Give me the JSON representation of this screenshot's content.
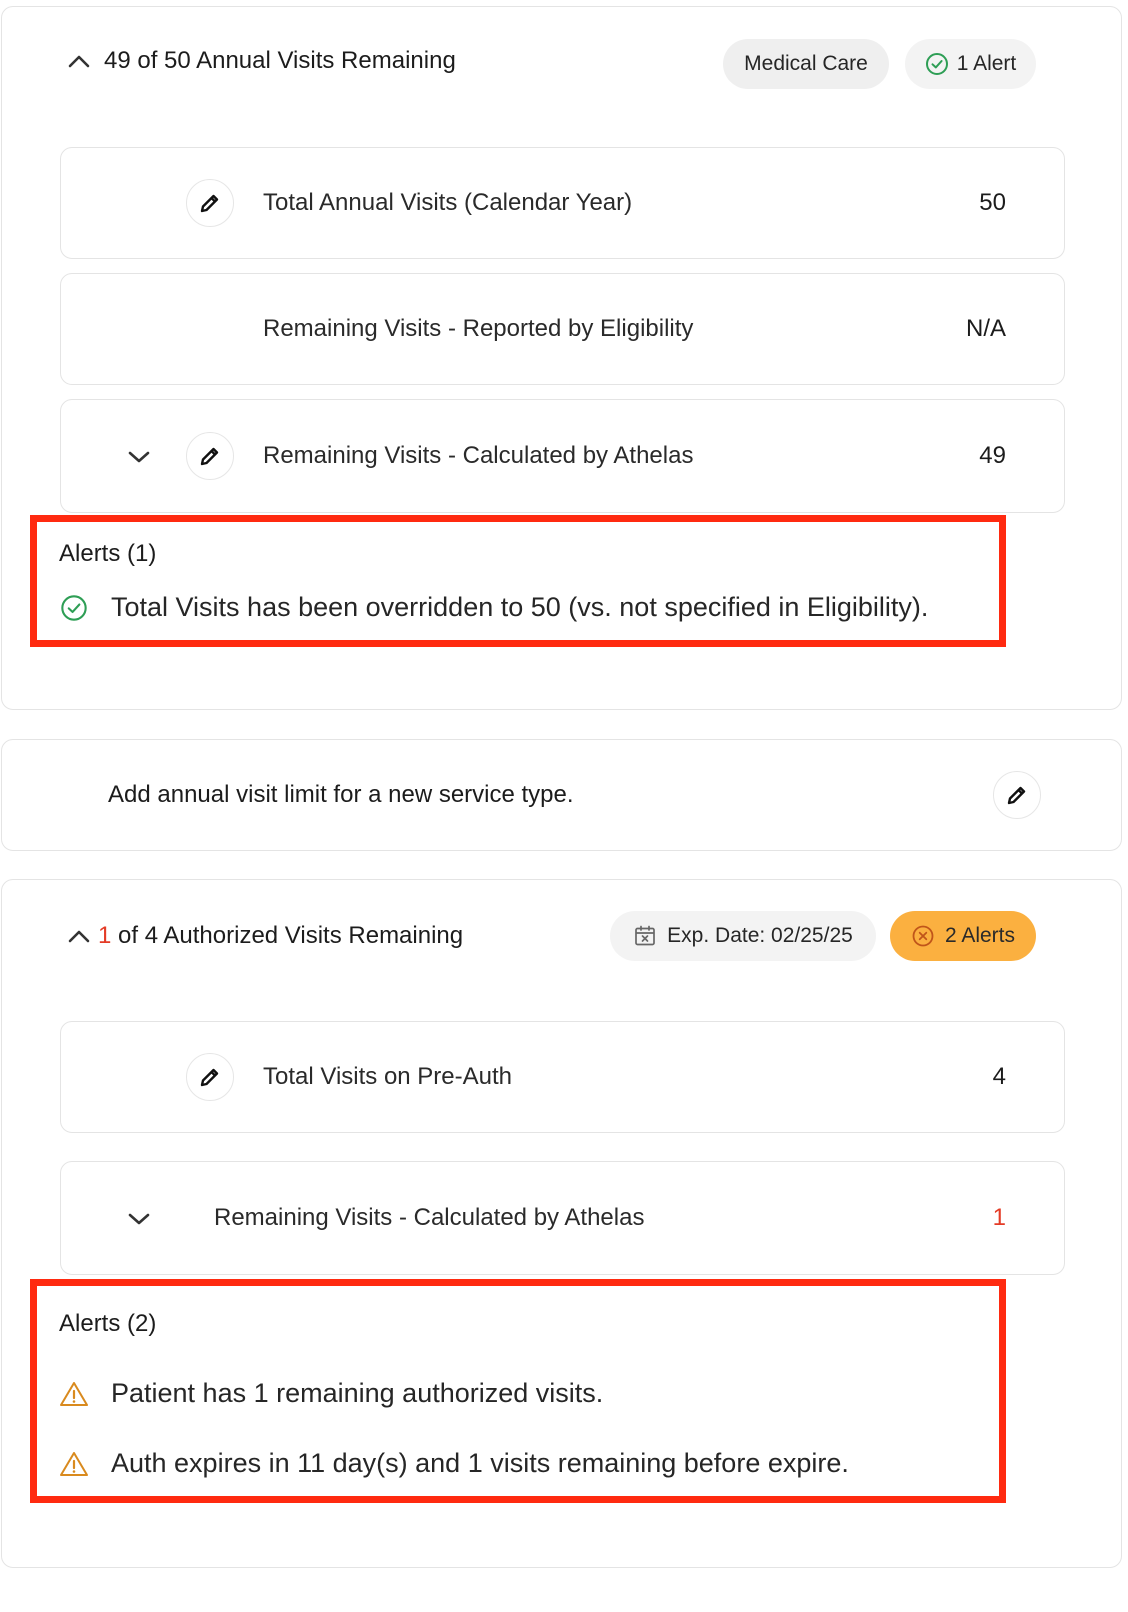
{
  "annual": {
    "header_title": "49 of 50 Annual Visits Remaining",
    "service_badge": "Medical Care",
    "alerts_badge": "1 Alert",
    "rows": [
      {
        "label": "Total Annual Visits (Calendar Year)",
        "value": "50"
      },
      {
        "label": "Remaining Visits - Reported by Eligibility",
        "value": "N/A"
      },
      {
        "label": "Remaining Visits - Calculated by Athelas",
        "value": "49"
      }
    ],
    "alerts_title": "Alerts (1)",
    "alerts": [
      "Total Visits has been overridden to 50 (vs. not specified in Eligibility)."
    ]
  },
  "add_limit": {
    "text": "Add annual visit limit for a new service type."
  },
  "authorized": {
    "header_count": "1",
    "header_rest": " of 4 Authorized Visits Remaining",
    "exp_badge": "Exp. Date: 02/25/25",
    "alerts_badge": "2 Alerts",
    "rows": [
      {
        "label": "Total Visits on Pre-Auth",
        "value": "4"
      },
      {
        "label": "Remaining Visits - Calculated by Athelas",
        "value": "1"
      }
    ],
    "alerts_title": "Alerts (2)",
    "alerts": [
      "Patient has 1 remaining authorized visits.",
      "Auth expires in 11 day(s) and 1 visits remaining before expire."
    ]
  },
  "colors": {
    "success": "#2e9e55",
    "warning": "#d98a1e",
    "danger_text": "#e43b26",
    "alert_badge_bg": "#fbb040",
    "highlight_border": "#ff2a10"
  }
}
